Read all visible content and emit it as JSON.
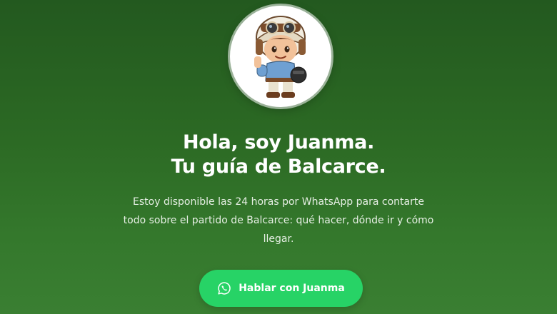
{
  "hero": {
    "avatar_icon": "guide-character-with-helmet-icon",
    "title_line1": "Hola, soy Juanma.",
    "title_line2": "Tu guía de Balcarce.",
    "description": "Estoy disponible las 24 horas por WhatsApp para contarte todo sobre el partido de Balcarce: qué hacer, dónde ir y cómo llegar."
  },
  "cta": {
    "label": "Hablar con Juanma",
    "icon": "whatsapp-icon"
  },
  "colors": {
    "background_top": "#23591f",
    "background_bottom": "#3a7f32",
    "button": "#27d366",
    "text": "#ffffff"
  }
}
